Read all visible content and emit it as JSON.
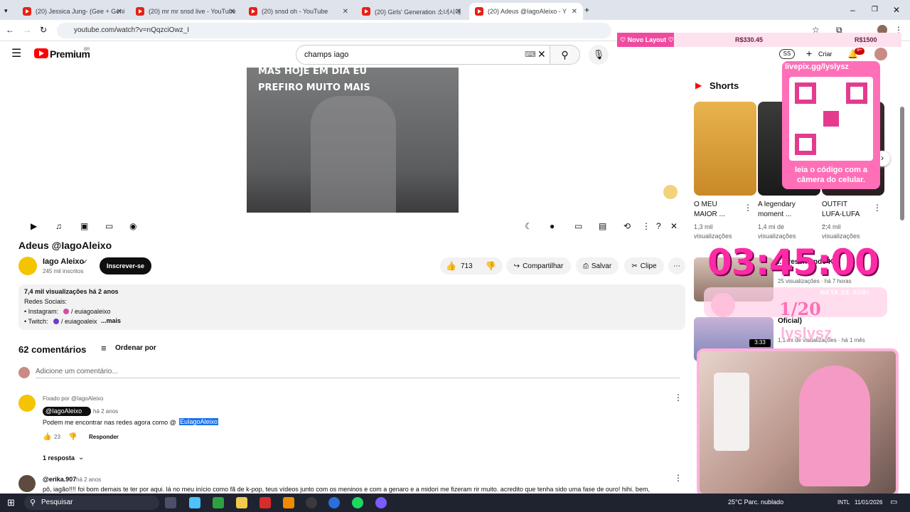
{
  "browser": {
    "tabs": [
      {
        "label": "(20) Jessica Jung- (Gee + Geni"
      },
      {
        "label": "(20) mr mr snsd live - YouTube"
      },
      {
        "label": "(20) snsd oh - YouTube"
      },
      {
        "label": "(20) Girls' Generation 소녀시대"
      },
      {
        "label": "(20) Adeus @IagoAleixo - Y"
      }
    ],
    "url": "youtube.com/watch?v=nQqzciOwz_I"
  },
  "overlay": {
    "novo_layout": "♡ Novo Layout ♡",
    "amount1": "R$330.45",
    "amount2": "R$1500",
    "livepix": "livepix.gg/lyslysz",
    "qr_text": "leia o código com a câmera do celular.",
    "timer": "03:45:00",
    "meta": "META DE SUB!",
    "meta_count": "1/20",
    "watermark": "lyslysz"
  },
  "header": {
    "logo_text": "Premium",
    "logo_region": "BR",
    "search_value": "champs iago",
    "avatar_initials": "SS",
    "create_label": "Criar",
    "notif_count": "9+"
  },
  "video": {
    "caption_line1": "MAS HOJE EM DIA EU",
    "caption_line2": "PREFIRO MUITO MAIS",
    "title": "Adeus @IagoAleixo"
  },
  "channel": {
    "name": "Iago Aleixo",
    "subs": "245 mil inscritos",
    "subscribe": "Inscrever-se"
  },
  "actions": {
    "likes": "713",
    "share": "Compartilhar",
    "save": "Salvar",
    "clip": "Clipe"
  },
  "description": {
    "stats": "7,4 mil visualizações  há 2 anos",
    "line1": "Redes Sociais:",
    "line2_prefix": "• Instagram:",
    "line2_link": "/ euiagoaleixo",
    "line3_prefix": "• Twitch:",
    "line3_link": "/ euiagoaleix",
    "more": "...mais"
  },
  "comments": {
    "count": "62 comentários",
    "sort": "Ordenar por",
    "add_placeholder": "Adicione um comentário...",
    "pinned_label": "Fixado por @IagoAleixo",
    "c1_author": "@IagoAleixo",
    "c1_time": "há 2 anos",
    "c1_text": "Podem me encontrar nas redes agora como @",
    "c1_highlight": "EuIagoAleixo",
    "c1_likes": "23",
    "reply": "Responder",
    "replies": "1 resposta",
    "c2_author": "@erika.907",
    "c2_time": "há 2 anos",
    "c2_text": "pô, iagão!!!! foi bom demais te ter por aqui. lá no meu início como fã de k-pop, teus vídeos junto com os meninos e com a genaro e a midori me fizeram rir muito. acredito que tenha sido uma fase de ouro! hihi. bem,"
  },
  "shorts": {
    "heading": "Shorts",
    "items": [
      {
        "title": "O MEU MAIOR ...",
        "views": "1,3 mil visualizações"
      },
      {
        "title": "A legendary moment ...",
        "views": "1,4 mi de visualizações"
      },
      {
        "title": "OUTFIT LUFA-LUFA ...",
        "views": "2,4 mil visualizações"
      }
    ]
  },
  "sidebar": {
    "v1_title": "...presentando K...",
    "v1_meta": "25 visualizações · há 7 horas",
    "v2_title": "Oficial)",
    "v2_meta": "1,1 mi de visualizações · há 1 mês",
    "v2_duration": "3:33"
  },
  "taskbar": {
    "search": "Pesquisar",
    "weather": "25°C  Parc. nublado",
    "lang": "INTL",
    "date": "11/01/2026"
  },
  "colors": {
    "accent": "#ff0000",
    "overlay_pink": "#ff2aa6",
    "taskbar": "#1f2330"
  }
}
